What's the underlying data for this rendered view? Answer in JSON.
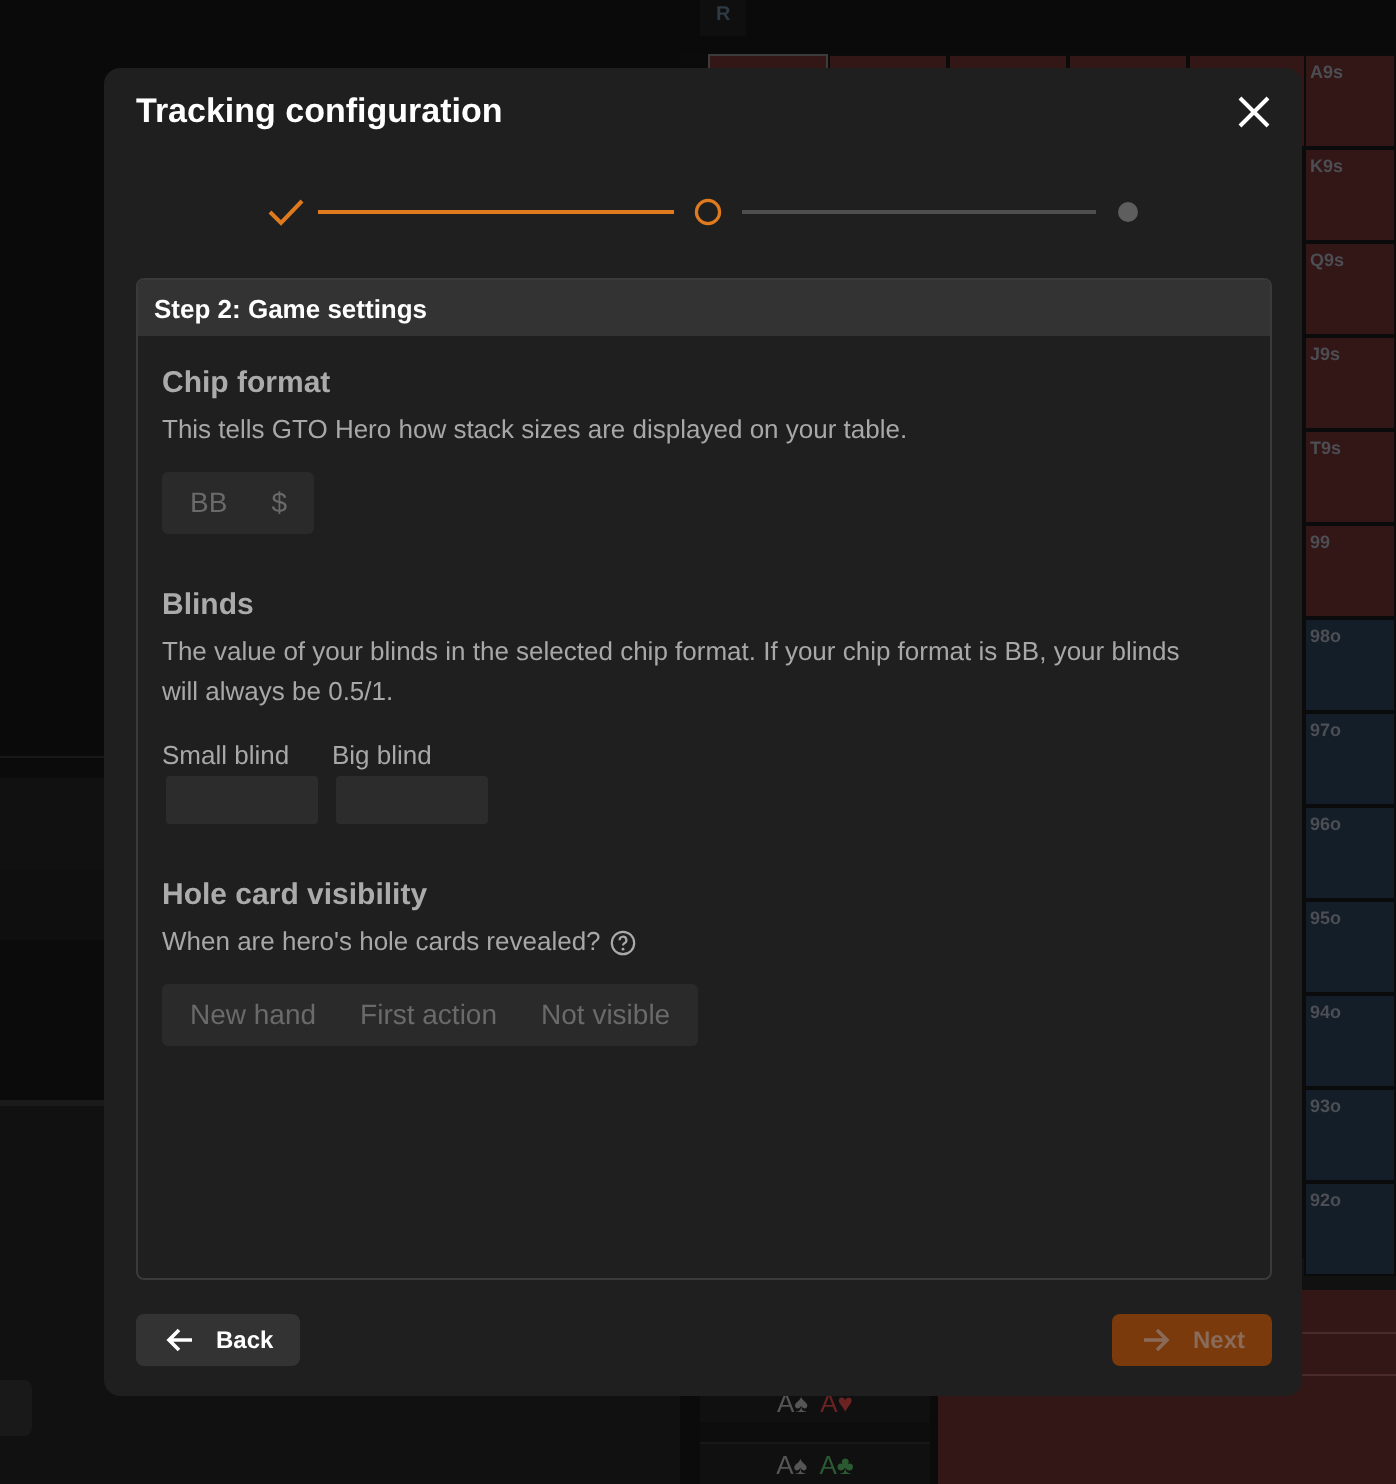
{
  "background": {
    "tab": "R",
    "right_column": [
      {
        "label": "A9s",
        "color": "#331616"
      },
      {
        "label": "K9s",
        "color": "#331616"
      },
      {
        "label": "Q9s",
        "color": "#331616"
      },
      {
        "label": "J9s",
        "color": "#331616"
      },
      {
        "label": "T9s",
        "color": "#331616"
      },
      {
        "label": "99",
        "color": "#331616"
      },
      {
        "label": "98o",
        "color": "#141e28"
      },
      {
        "label": "97o",
        "color": "#141e28"
      },
      {
        "label": "96o",
        "color": "#141e28"
      },
      {
        "label": "95o",
        "color": "#141e28"
      },
      {
        "label": "94o",
        "color": "#141e28"
      },
      {
        "label": "93o",
        "color": "#141e28"
      },
      {
        "label": "92o",
        "color": "#141e28"
      }
    ],
    "hands": [
      [
        {
          "rank": "A",
          "suit": "♠",
          "color": "#555555"
        },
        {
          "rank": "A",
          "suit": "♥",
          "color": "#6a2222"
        }
      ],
      [
        {
          "rank": "A",
          "suit": "♠",
          "color": "#555555"
        },
        {
          "rank": "A",
          "suit": "♣",
          "color": "#2a5a30"
        }
      ]
    ]
  },
  "dialog": {
    "title": "Tracking configuration",
    "steps": [
      {
        "kind": "done"
      },
      {
        "kind": "current"
      },
      {
        "kind": "pending"
      }
    ],
    "panel_title": "Step 2: Game settings",
    "sections": [
      {
        "kind": "toggle",
        "heading": "Chip format",
        "description": "This tells GTO Hero how stack sizes are displayed on your table.",
        "options": [
          {
            "label": "BB",
            "selected": false
          },
          {
            "label": "$",
            "selected": false
          }
        ]
      },
      {
        "kind": "fields",
        "heading": "Blinds",
        "description": "The value of your blinds in the selected chip format. If your chip format is BB, your blinds will always be 0.5/1.",
        "fields": [
          {
            "label": "Small blind"
          },
          {
            "label": "Big blind"
          }
        ]
      },
      {
        "kind": "toggle",
        "heading": "Hole card visibility",
        "description": "When are hero's hole cards revealed?",
        "help": true,
        "options": [
          {
            "label": "New hand",
            "selected": false
          },
          {
            "label": "First action",
            "selected": false
          },
          {
            "label": "Not visible",
            "selected": false
          }
        ]
      }
    ],
    "back": "Back",
    "next": {
      "label": "Next",
      "disabled": true
    }
  }
}
